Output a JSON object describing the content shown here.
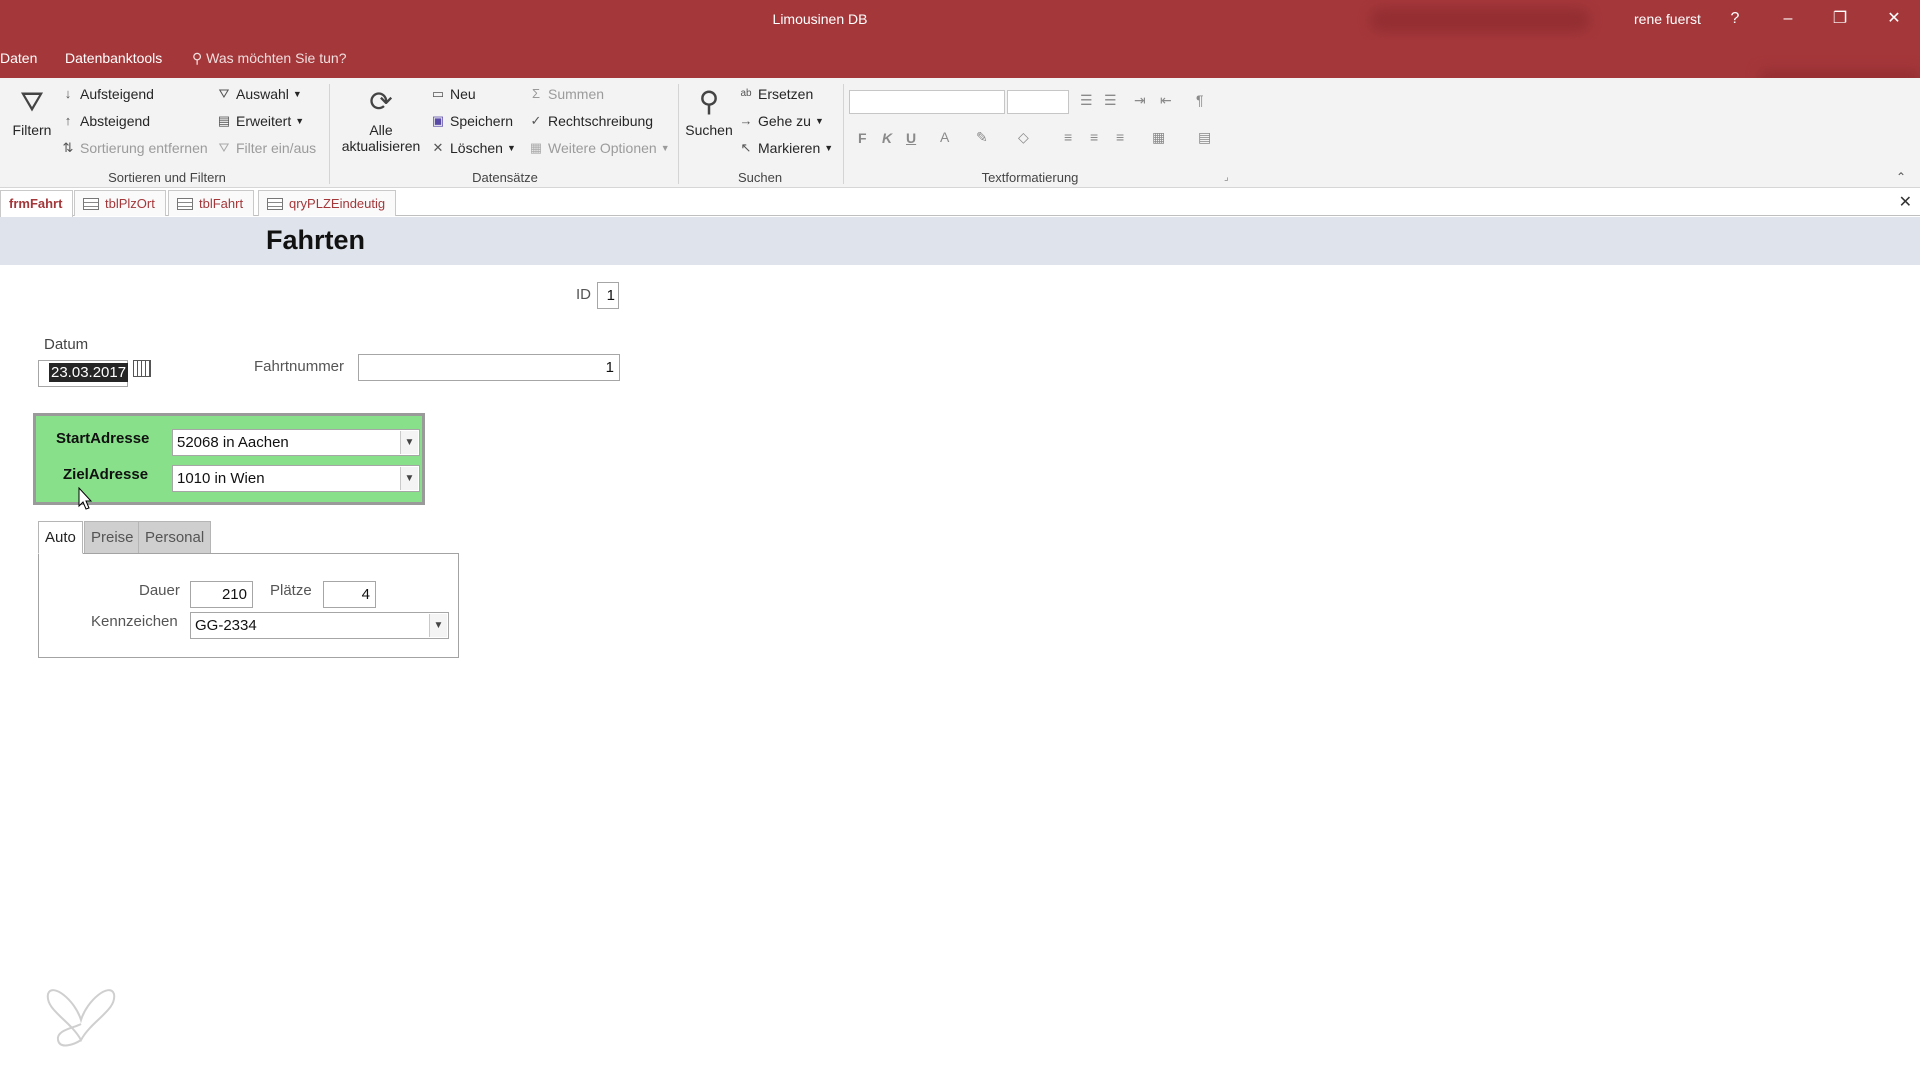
{
  "app": {
    "title": "Limousinen DB",
    "user": "rene fuerst"
  },
  "window_buttons": {
    "help": "?",
    "minimize": "–",
    "restore": "❐",
    "close": "✕"
  },
  "menu": {
    "tabs": [
      "Daten",
      "Datenbanktools"
    ],
    "tellme": "Was möchten Sie tun?"
  },
  "ribbon": {
    "sortfilter": {
      "filter": "Filtern",
      "asc": "Aufsteigend",
      "desc": "Absteigend",
      "remove_sort": "Sortierung entfernen",
      "selection": "Auswahl",
      "advanced": "Erweitert",
      "toggle_filter": "Filter ein/aus",
      "group": "Sortieren und Filtern"
    },
    "records": {
      "refresh_line1": "Alle",
      "refresh_line2": "aktualisieren",
      "new": "Neu",
      "save": "Speichern",
      "delete": "Löschen",
      "totals": "Summen",
      "spelling": "Rechtschreibung",
      "more": "Weitere Optionen",
      "group": "Datensätze"
    },
    "find": {
      "find": "Suchen",
      "replace": "Ersetzen",
      "goto": "Gehe zu",
      "select": "Markieren",
      "group": "Suchen"
    },
    "textformat": {
      "bold": "F",
      "italic": "K",
      "underline": "U",
      "group": "Textformatierung"
    }
  },
  "doc_tabs": [
    "frmFahrt",
    "tblPlzOrt",
    "tblFahrt",
    "qryPLZEindeutig"
  ],
  "form": {
    "title": "Fahrten",
    "id_label": "ID",
    "id_value": "1",
    "datum_label": "Datum",
    "datum_value": "23.03.2017",
    "fahrtnummer_label": "Fahrtnummer",
    "fahrtnummer_value": "1",
    "start_label": "StartAdresse",
    "start_value": "52068 in Aachen",
    "ziel_label": "ZielAdresse",
    "ziel_value": "1010 in Wien",
    "tabs": [
      "Auto",
      "Preise",
      "Personal"
    ],
    "dauer_label": "Dauer",
    "dauer_value": "210",
    "plaetze_label": "Plätze",
    "plaetze_value": "4",
    "kennzeichen_label": "Kennzeichen",
    "kennzeichen_value": "GG-2334"
  },
  "colors": {
    "accent": "#A4373A",
    "highlight_green": "#88E18A",
    "form_header": "#DFE3EB"
  }
}
